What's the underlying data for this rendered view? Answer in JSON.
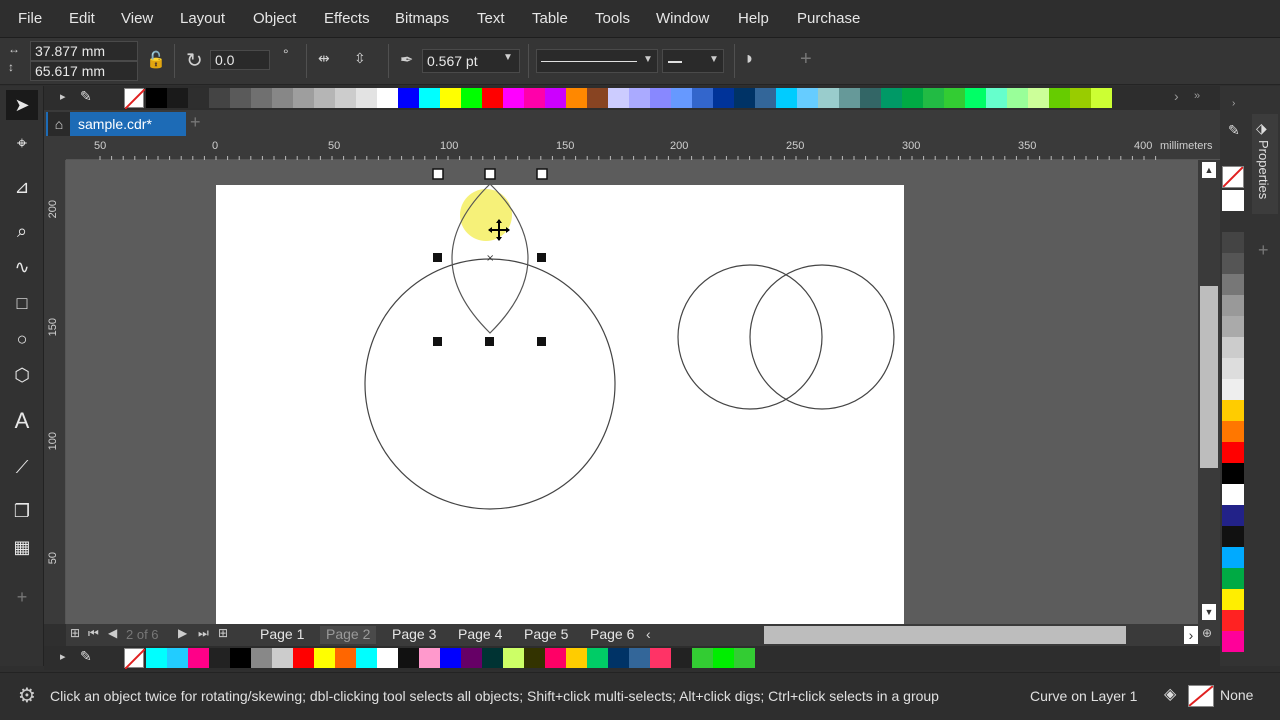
{
  "menu": [
    "File",
    "Edit",
    "View",
    "Layout",
    "Object",
    "Effects",
    "Bitmaps",
    "Text",
    "Table",
    "Tools",
    "Window",
    "Help",
    "Purchase"
  ],
  "propbar": {
    "width_value": "37.877 mm",
    "height_value": "65.617 mm",
    "rotation_value": "0.0",
    "outline_width": "0.567 pt"
  },
  "doc_tab": "sample.cdr*",
  "ruler": {
    "h_labels": [
      "50",
      "0",
      "50",
      "100",
      "150",
      "200",
      "250",
      "300",
      "350",
      "400",
      "millimeters"
    ],
    "v_labels": [
      "200",
      "150",
      "100",
      "50"
    ]
  },
  "page_nav": {
    "counter": "2 of 6"
  },
  "pages": [
    "Page 1",
    "Page 2",
    "Page 3",
    "Page 4",
    "Page 5",
    "Page 6"
  ],
  "status": {
    "hint": "Click an object twice for rotating/skewing; dbl-clicking tool selects all objects; Shift+click multi-selects; Alt+click digs; Ctrl+click selects in a group",
    "object_info": "Curve on Layer 1",
    "fill": "None"
  },
  "docker": {
    "title": "Properties"
  },
  "colors": {
    "accent": "#1d6bb6",
    "highlight": "#f5f06a",
    "palette_top": [
      "#000000",
      "#1a1a1a",
      "#2e2e2e",
      "#444444",
      "#5a5a5a",
      "#707070",
      "#878787",
      "#9e9e9e",
      "#b5b5b5",
      "#cccccc",
      "#e3e3e3",
      "#ffffff",
      "#0000ff",
      "#00ffff",
      "#ffff00",
      "#00ff00",
      "#ff0000",
      "#ff00ff",
      "#ff00aa",
      "#cc00ff",
      "#ff8800",
      "#884422",
      "#ccccff",
      "#aaaaff",
      "#8888ff",
      "#6699ff",
      "#3366cc",
      "#003399",
      "#003366",
      "#336699",
      "#00ccff",
      "#66ccff",
      "#99cccc",
      "#669999",
      "#336666",
      "#009966",
      "#00aa44",
      "#22bb44",
      "#33cc33",
      "#00ff66",
      "#66ffcc",
      "#99ff99",
      "#ccff99",
      "#66cc00",
      "#99cc00",
      "#ccff33"
    ],
    "palette_bottom": [
      "#00ffff",
      "#22ccff",
      "#ff0088",
      "#222222",
      "#000000",
      "#888888",
      "#cccccc",
      "#ff0000",
      "#ffff00",
      "#ff6600",
      "#00ffff",
      "#ffffff",
      "#111111",
      "#ff99cc",
      "#0000ff",
      "#660066",
      "#003333",
      "#ccff66",
      "#333300",
      "#ff0066",
      "#ffcc00",
      "#00cc66",
      "#003366",
      "#336699",
      "#ff3366",
      "#222222",
      "#33cc33",
      "#00ee00",
      "#33cc33"
    ],
    "palette_right": [
      "#ffffff",
      "#333333",
      "#444444",
      "#555555",
      "#777777",
      "#999999",
      "#aaaaaa",
      "#cccccc",
      "#dddddd",
      "#eeeeee",
      "#ffcc00",
      "#ff7700",
      "#ff0000",
      "#000000",
      "#ffffff",
      "#222288",
      "#111111",
      "#00aaff",
      "#00aa44",
      "#ffee00",
      "#ff2222",
      "#ff0099"
    ]
  }
}
